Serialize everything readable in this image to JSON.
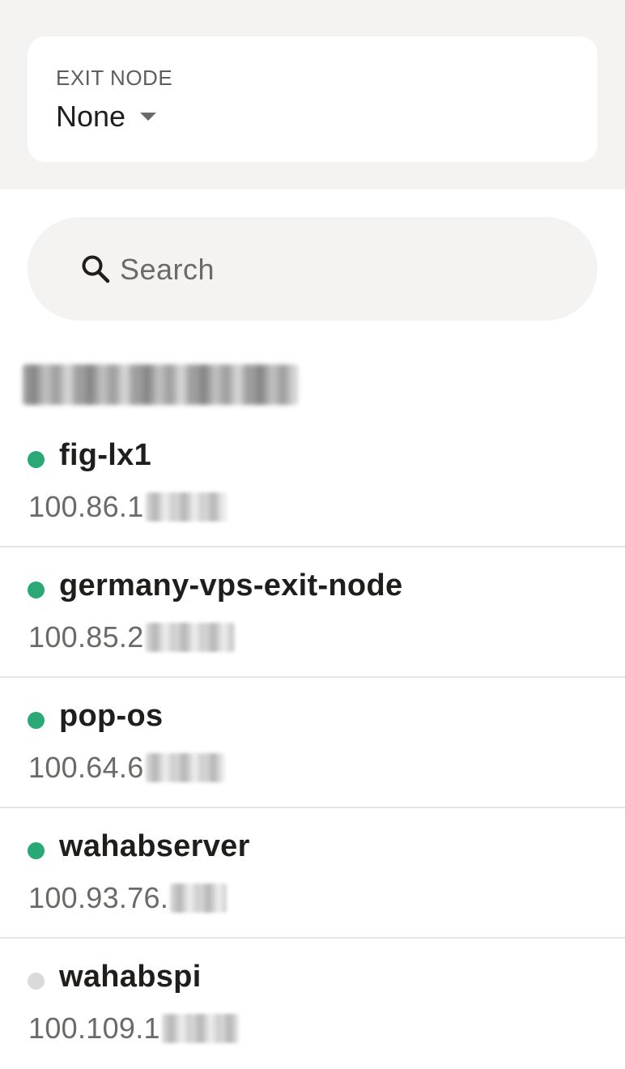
{
  "exit_node": {
    "label": "EXIT NODE",
    "value": "None"
  },
  "search": {
    "placeholder": "Search"
  },
  "devices": [
    {
      "name": "fig-lx1",
      "ip": "100.86.1",
      "status": "online"
    },
    {
      "name": "germany-vps-exit-node",
      "ip": "100.85.2",
      "status": "online"
    },
    {
      "name": "pop-os",
      "ip": "100.64.6",
      "status": "online"
    },
    {
      "name": "wahabserver",
      "ip": "100.93.76.",
      "status": "online"
    },
    {
      "name": "wahabspi",
      "ip": "100.109.1",
      "status": "offline"
    }
  ],
  "colors": {
    "online": "#2aa876",
    "offline": "#dcdad8",
    "section_bg": "#f4f3f1"
  }
}
